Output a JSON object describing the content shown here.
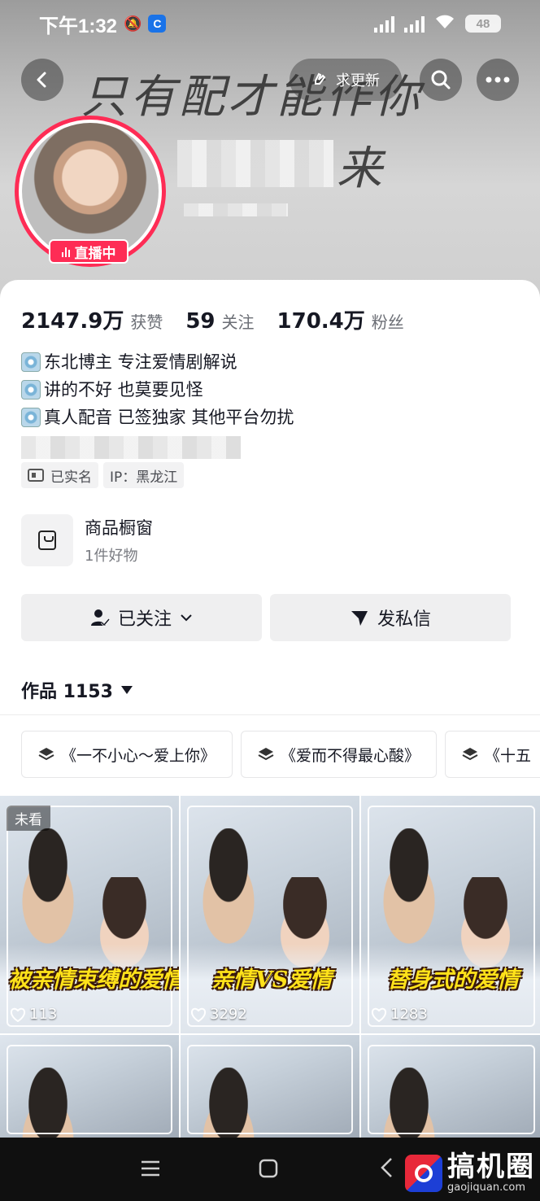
{
  "status_bar": {
    "time": "下午1:32",
    "battery": "48"
  },
  "header": {
    "banner_line1": "只有配才能作你",
    "banner_line2": "来",
    "update_request": "求更新",
    "live_badge": "直播中"
  },
  "stats": [
    {
      "num": "2147.9万",
      "label": "获赞"
    },
    {
      "num": "59",
      "label": "关注"
    },
    {
      "num": "170.4万",
      "label": "粉丝"
    }
  ],
  "bio": [
    "东北博主 专注爱情剧解说",
    "讲的不好  也莫要见怪",
    "真人配音 已签独家 其他平台勿扰"
  ],
  "tags": {
    "verified": "已实名",
    "ip": "IP：黑龙江"
  },
  "shop": {
    "title": "商品橱窗",
    "subtitle": "1件好物"
  },
  "buttons": {
    "followed": "已关注",
    "message": "发私信"
  },
  "works": {
    "label": "作品 1153"
  },
  "playlists": [
    "《一不小心～爱上你》",
    "《爱而不得最心酸》",
    "《十五"
  ],
  "videos": [
    {
      "caption": "被亲情束缚的爱情",
      "likes": "113",
      "unseen": "未看"
    },
    {
      "caption": "亲情VS爱情",
      "likes": "3292"
    },
    {
      "caption": "替身式的爱情",
      "likes": "1283"
    }
  ],
  "watermark": {
    "cn": "搞机圈",
    "en": "gaojiquan.com"
  },
  "colors": {
    "accent": "#fe2c55",
    "caption_yellow": "#ffe21a"
  }
}
